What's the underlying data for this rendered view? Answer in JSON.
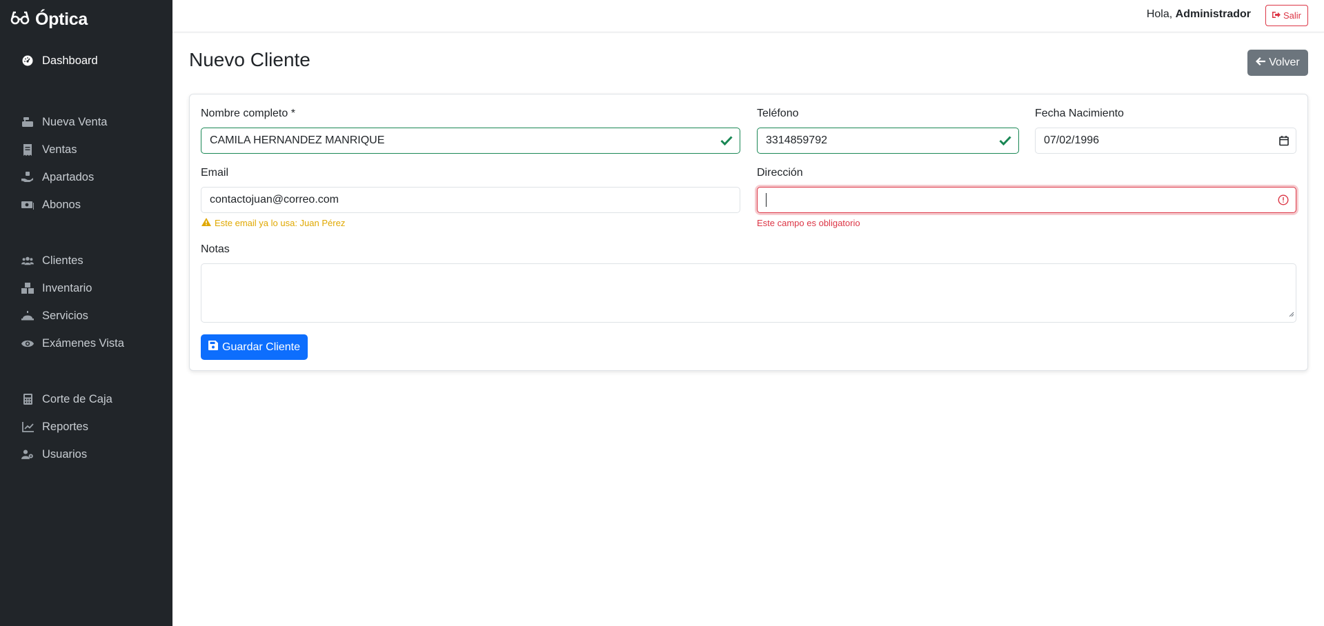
{
  "app": {
    "brand": "Óptica",
    "brand_icon": "glasses-icon"
  },
  "sidebar": {
    "items": [
      {
        "label": "Dashboard",
        "icon": "dashboard-gauge-icon"
      },
      {
        "label": "Nueva Venta",
        "icon": "cash-register-icon"
      },
      {
        "label": "Ventas",
        "icon": "receipt-icon"
      },
      {
        "label": "Apartados",
        "icon": "hand-holding-icon"
      },
      {
        "label": "Abonos",
        "icon": "money-bill-icon"
      },
      {
        "label": "Clientes",
        "icon": "users-icon"
      },
      {
        "label": "Inventario",
        "icon": "boxes-icon"
      },
      {
        "label": "Servicios",
        "icon": "service-bell-icon"
      },
      {
        "label": "Exámenes Vista",
        "icon": "eye-icon"
      },
      {
        "label": "Corte de Caja",
        "icon": "calculator-icon"
      },
      {
        "label": "Reportes",
        "icon": "line-chart-icon"
      },
      {
        "label": "Usuarios",
        "icon": "user-gear-icon"
      }
    ]
  },
  "topbar": {
    "greeting_prefix": "Hola,",
    "user_name": "Administrador",
    "logout_label": "Salir"
  },
  "page": {
    "title": "Nuevo Cliente",
    "back_label": "Volver"
  },
  "form": {
    "nombre": {
      "label": "Nombre completo *",
      "value": "CAMILA HERNANDEZ MANRIQUE",
      "state": "valid"
    },
    "telefono": {
      "label": "Teléfono",
      "value": "3314859792",
      "state": "valid"
    },
    "fecha": {
      "label": "Fecha Nacimiento",
      "value": "07/02/1996"
    },
    "email": {
      "label": "Email",
      "value": "contactojuan@correo.com",
      "warning": "Este email ya lo usa: Juan Pérez"
    },
    "direccion": {
      "label": "Dirección",
      "value": "",
      "state": "invalid",
      "error": "Este campo es obligatorio"
    },
    "notas": {
      "label": "Notas",
      "value": ""
    },
    "submit_label": "Guardar Cliente"
  },
  "colors": {
    "sidebar_bg": "#212529",
    "primary": "#0d6efd",
    "secondary": "#6c757d",
    "success": "#198754",
    "danger": "#dc3545",
    "warning": "#e0a800"
  }
}
